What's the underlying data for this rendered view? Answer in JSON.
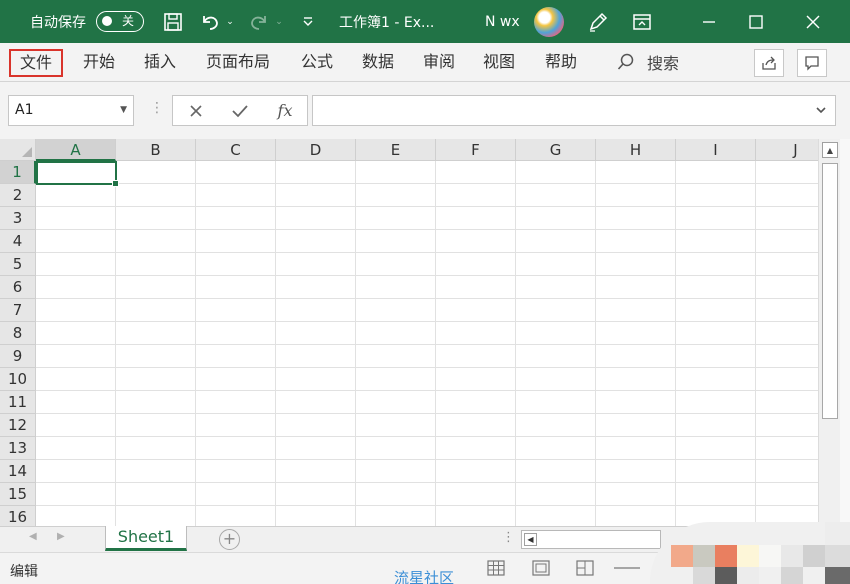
{
  "titlebar": {
    "autosave_label": "自动保存",
    "autosave_state": "关",
    "title": "工作簿1  -  Ex...",
    "user_name": "N wx",
    "icons": [
      "save-icon",
      "undo-icon",
      "redo-icon",
      "customize-toolbar-icon",
      "pen-icon",
      "ribbon-display-icon",
      "minimize-icon",
      "maximize-icon",
      "close-icon"
    ]
  },
  "menu": {
    "items": [
      "文件",
      "开始",
      "插入",
      "页面布局",
      "公式",
      "数据",
      "审阅",
      "视图",
      "帮助"
    ],
    "search_label": "搜索"
  },
  "formula_bar": {
    "name_box": "A1",
    "fx_label": "fx",
    "value": ""
  },
  "grid": {
    "columns": [
      "A",
      "B",
      "C",
      "D",
      "E",
      "F",
      "G",
      "H",
      "I",
      "J"
    ],
    "rows": [
      "1",
      "2",
      "3",
      "4",
      "5",
      "6",
      "7",
      "8",
      "9",
      "10",
      "11",
      "12",
      "13",
      "14",
      "15",
      "16"
    ],
    "selected_cell": "A1"
  },
  "sheets": {
    "tabs": [
      "Sheet1"
    ],
    "active": "Sheet1",
    "add_label": "+"
  },
  "status": {
    "mode": "编辑",
    "watermark": "流星社区"
  },
  "colors": {
    "accent": "#217346",
    "highlight": "#d9342b",
    "watermark": "#3c8fd6"
  }
}
